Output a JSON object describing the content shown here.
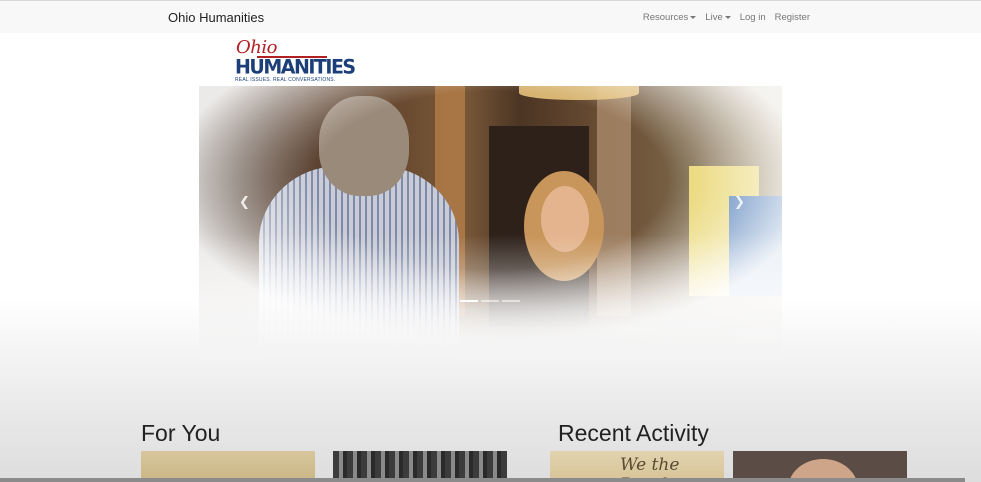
{
  "site": {
    "brand": "Ohio Humanities"
  },
  "nav": {
    "items": [
      {
        "label": "Resources",
        "dropdown": true
      },
      {
        "label": "Live",
        "dropdown": true
      },
      {
        "label": "Log in",
        "dropdown": false
      },
      {
        "label": "Register",
        "dropdown": false
      }
    ]
  },
  "logo": {
    "script_text": "Ohio",
    "main_text": "HUMANITIES",
    "tagline": "REAL ISSUES. REAL CONVERSATIONS."
  },
  "carousel": {
    "prev_icon": "chevron-left-icon",
    "next_icon": "chevron-right-icon",
    "slides": 3,
    "active_slide": 1
  },
  "sections": {
    "for_you": "For You",
    "recent_activity": "Recent Activity"
  },
  "cards": {
    "recent_card1_text": "We the People"
  },
  "colors": {
    "logo_red": "#b32024",
    "logo_blue": "#1c3f7a",
    "navbar_bg": "#f8f8f8"
  }
}
